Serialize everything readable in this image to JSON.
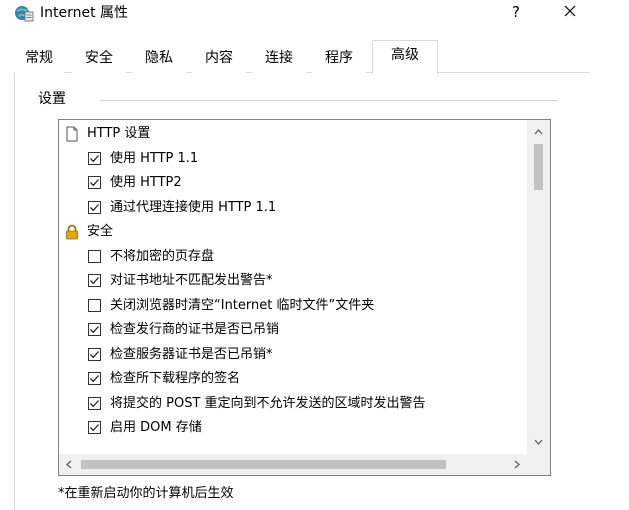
{
  "window": {
    "title": "Internet 属性",
    "help_label": "?",
    "close_icon": "close-icon",
    "app_icon": "internet-options-icon"
  },
  "tabs": [
    {
      "label": "常规",
      "active": false
    },
    {
      "label": "安全",
      "active": false
    },
    {
      "label": "隐私",
      "active": false
    },
    {
      "label": "内容",
      "active": false
    },
    {
      "label": "连接",
      "active": false
    },
    {
      "label": "程序",
      "active": false
    },
    {
      "label": "高级",
      "active": true
    }
  ],
  "settings": {
    "group_label": "设置",
    "items": [
      {
        "type": "category",
        "icon": "page-icon",
        "label": "HTTP 设置"
      },
      {
        "type": "checkbox",
        "checked": true,
        "label": "使用 HTTP 1.1"
      },
      {
        "type": "checkbox",
        "checked": true,
        "label": "使用 HTTP2"
      },
      {
        "type": "checkbox",
        "checked": true,
        "label": "通过代理连接使用 HTTP 1.1"
      },
      {
        "type": "category",
        "icon": "lock-icon",
        "label": "安全"
      },
      {
        "type": "checkbox",
        "checked": false,
        "label": "不将加密的页存盘"
      },
      {
        "type": "checkbox",
        "checked": true,
        "label": "对证书地址不匹配发出警告*"
      },
      {
        "type": "checkbox",
        "checked": false,
        "label": "关闭浏览器时清空“Internet 临时文件”文件夹"
      },
      {
        "type": "checkbox",
        "checked": true,
        "label": "检查发行商的证书是否已吊销"
      },
      {
        "type": "checkbox",
        "checked": true,
        "label": "检查服务器证书是否已吊销*"
      },
      {
        "type": "checkbox",
        "checked": true,
        "label": "检查所下载程序的签名"
      },
      {
        "type": "checkbox",
        "checked": true,
        "label": "将提交的 POST 重定向到不允许发送的区域时发出警告"
      },
      {
        "type": "checkbox",
        "checked": true,
        "label": "启用 DOM 存储"
      }
    ],
    "scroll_position": 0.55
  },
  "footnote": "*在重新启动你的计算机后生效",
  "colors": {
    "lock": "#e0a800",
    "border": "#828282"
  }
}
